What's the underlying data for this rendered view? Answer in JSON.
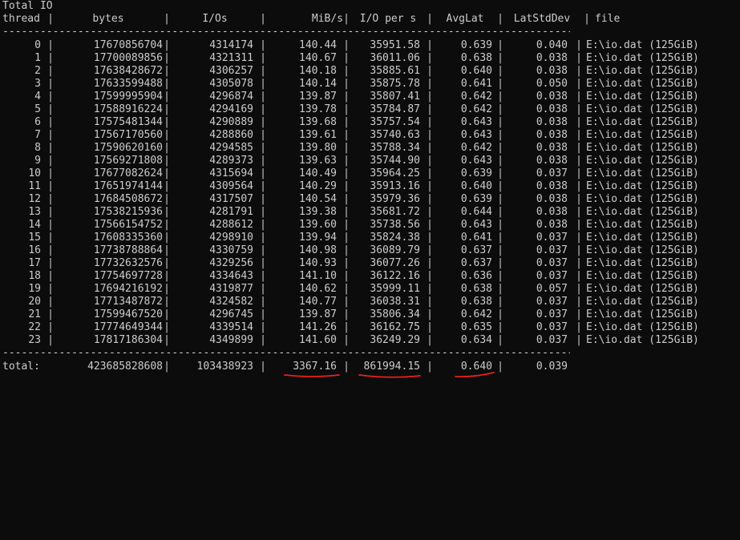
{
  "section_title": "Total IO",
  "headers": {
    "thread": "thread",
    "bytes": "bytes",
    "ios": "I/Os",
    "mibs": "MiB/s",
    "iops": "I/O per s",
    "avglat": "AvgLat",
    "latstd": "LatStdDev",
    "file": "file"
  },
  "separator_char": "|",
  "dash_text": "-----------------------------------------------------------------------------------------------------------------------------------",
  "rows": [
    {
      "thread": "0",
      "bytes": "17670856704",
      "ios": "4314174",
      "mibs": "140.44",
      "iops": "35951.58",
      "avglat": "0.639",
      "latstd": "0.040",
      "file": "E:\\io.dat (125GiB)"
    },
    {
      "thread": "1",
      "bytes": "17700089856",
      "ios": "4321311",
      "mibs": "140.67",
      "iops": "36011.06",
      "avglat": "0.638",
      "latstd": "0.038",
      "file": "E:\\io.dat (125GiB)"
    },
    {
      "thread": "2",
      "bytes": "17638428672",
      "ios": "4306257",
      "mibs": "140.18",
      "iops": "35885.61",
      "avglat": "0.640",
      "latstd": "0.038",
      "file": "E:\\io.dat (125GiB)"
    },
    {
      "thread": "3",
      "bytes": "17633599488",
      "ios": "4305078",
      "mibs": "140.14",
      "iops": "35875.78",
      "avglat": "0.641",
      "latstd": "0.050",
      "file": "E:\\io.dat (125GiB)"
    },
    {
      "thread": "4",
      "bytes": "17599995904",
      "ios": "4296874",
      "mibs": "139.87",
      "iops": "35807.41",
      "avglat": "0.642",
      "latstd": "0.038",
      "file": "E:\\io.dat (125GiB)"
    },
    {
      "thread": "5",
      "bytes": "17588916224",
      "ios": "4294169",
      "mibs": "139.78",
      "iops": "35784.87",
      "avglat": "0.642",
      "latstd": "0.038",
      "file": "E:\\io.dat (125GiB)"
    },
    {
      "thread": "6",
      "bytes": "17575481344",
      "ios": "4290889",
      "mibs": "139.68",
      "iops": "35757.54",
      "avglat": "0.643",
      "latstd": "0.038",
      "file": "E:\\io.dat (125GiB)"
    },
    {
      "thread": "7",
      "bytes": "17567170560",
      "ios": "4288860",
      "mibs": "139.61",
      "iops": "35740.63",
      "avglat": "0.643",
      "latstd": "0.038",
      "file": "E:\\io.dat (125GiB)"
    },
    {
      "thread": "8",
      "bytes": "17590620160",
      "ios": "4294585",
      "mibs": "139.80",
      "iops": "35788.34",
      "avglat": "0.642",
      "latstd": "0.038",
      "file": "E:\\io.dat (125GiB)"
    },
    {
      "thread": "9",
      "bytes": "17569271808",
      "ios": "4289373",
      "mibs": "139.63",
      "iops": "35744.90",
      "avglat": "0.643",
      "latstd": "0.038",
      "file": "E:\\io.dat (125GiB)"
    },
    {
      "thread": "10",
      "bytes": "17677082624",
      "ios": "4315694",
      "mibs": "140.49",
      "iops": "35964.25",
      "avglat": "0.639",
      "latstd": "0.037",
      "file": "E:\\io.dat (125GiB)"
    },
    {
      "thread": "11",
      "bytes": "17651974144",
      "ios": "4309564",
      "mibs": "140.29",
      "iops": "35913.16",
      "avglat": "0.640",
      "latstd": "0.038",
      "file": "E:\\io.dat (125GiB)"
    },
    {
      "thread": "12",
      "bytes": "17684508672",
      "ios": "4317507",
      "mibs": "140.54",
      "iops": "35979.36",
      "avglat": "0.639",
      "latstd": "0.038",
      "file": "E:\\io.dat (125GiB)"
    },
    {
      "thread": "13",
      "bytes": "17538215936",
      "ios": "4281791",
      "mibs": "139.38",
      "iops": "35681.72",
      "avglat": "0.644",
      "latstd": "0.038",
      "file": "E:\\io.dat (125GiB)"
    },
    {
      "thread": "14",
      "bytes": "17566154752",
      "ios": "4288612",
      "mibs": "139.60",
      "iops": "35738.56",
      "avglat": "0.643",
      "latstd": "0.038",
      "file": "E:\\io.dat (125GiB)"
    },
    {
      "thread": "15",
      "bytes": "17608335360",
      "ios": "4298910",
      "mibs": "139.94",
      "iops": "35824.38",
      "avglat": "0.641",
      "latstd": "0.037",
      "file": "E:\\io.dat (125GiB)"
    },
    {
      "thread": "16",
      "bytes": "17738788864",
      "ios": "4330759",
      "mibs": "140.98",
      "iops": "36089.79",
      "avglat": "0.637",
      "latstd": "0.037",
      "file": "E:\\io.dat (125GiB)"
    },
    {
      "thread": "17",
      "bytes": "17732632576",
      "ios": "4329256",
      "mibs": "140.93",
      "iops": "36077.26",
      "avglat": "0.637",
      "latstd": "0.037",
      "file": "E:\\io.dat (125GiB)"
    },
    {
      "thread": "18",
      "bytes": "17754697728",
      "ios": "4334643",
      "mibs": "141.10",
      "iops": "36122.16",
      "avglat": "0.636",
      "latstd": "0.037",
      "file": "E:\\io.dat (125GiB)"
    },
    {
      "thread": "19",
      "bytes": "17694216192",
      "ios": "4319877",
      "mibs": "140.62",
      "iops": "35999.11",
      "avglat": "0.638",
      "latstd": "0.057",
      "file": "E:\\io.dat (125GiB)"
    },
    {
      "thread": "20",
      "bytes": "17713487872",
      "ios": "4324582",
      "mibs": "140.77",
      "iops": "36038.31",
      "avglat": "0.638",
      "latstd": "0.037",
      "file": "E:\\io.dat (125GiB)"
    },
    {
      "thread": "21",
      "bytes": "17599467520",
      "ios": "4296745",
      "mibs": "139.87",
      "iops": "35806.34",
      "avglat": "0.642",
      "latstd": "0.037",
      "file": "E:\\io.dat (125GiB)"
    },
    {
      "thread": "22",
      "bytes": "17774649344",
      "ios": "4339514",
      "mibs": "141.26",
      "iops": "36162.75",
      "avglat": "0.635",
      "latstd": "0.037",
      "file": "E:\\io.dat (125GiB)"
    },
    {
      "thread": "23",
      "bytes": "17817186304",
      "ios": "4349899",
      "mibs": "141.60",
      "iops": "36249.29",
      "avglat": "0.634",
      "latstd": "0.037",
      "file": "E:\\io.dat (125GiB)"
    }
  ],
  "total": {
    "label": "total:",
    "bytes": "423685828608",
    "ios": "103438923",
    "mibs": "3367.16",
    "iops": "861994.15",
    "avglat": "0.640",
    "latstd": "0.039"
  },
  "colors": {
    "background": "#0c0c0c",
    "text": "#cccccc",
    "underline": "#e8221a"
  },
  "underlined_values": [
    "3367.16",
    "861994.15",
    "0.640"
  ]
}
